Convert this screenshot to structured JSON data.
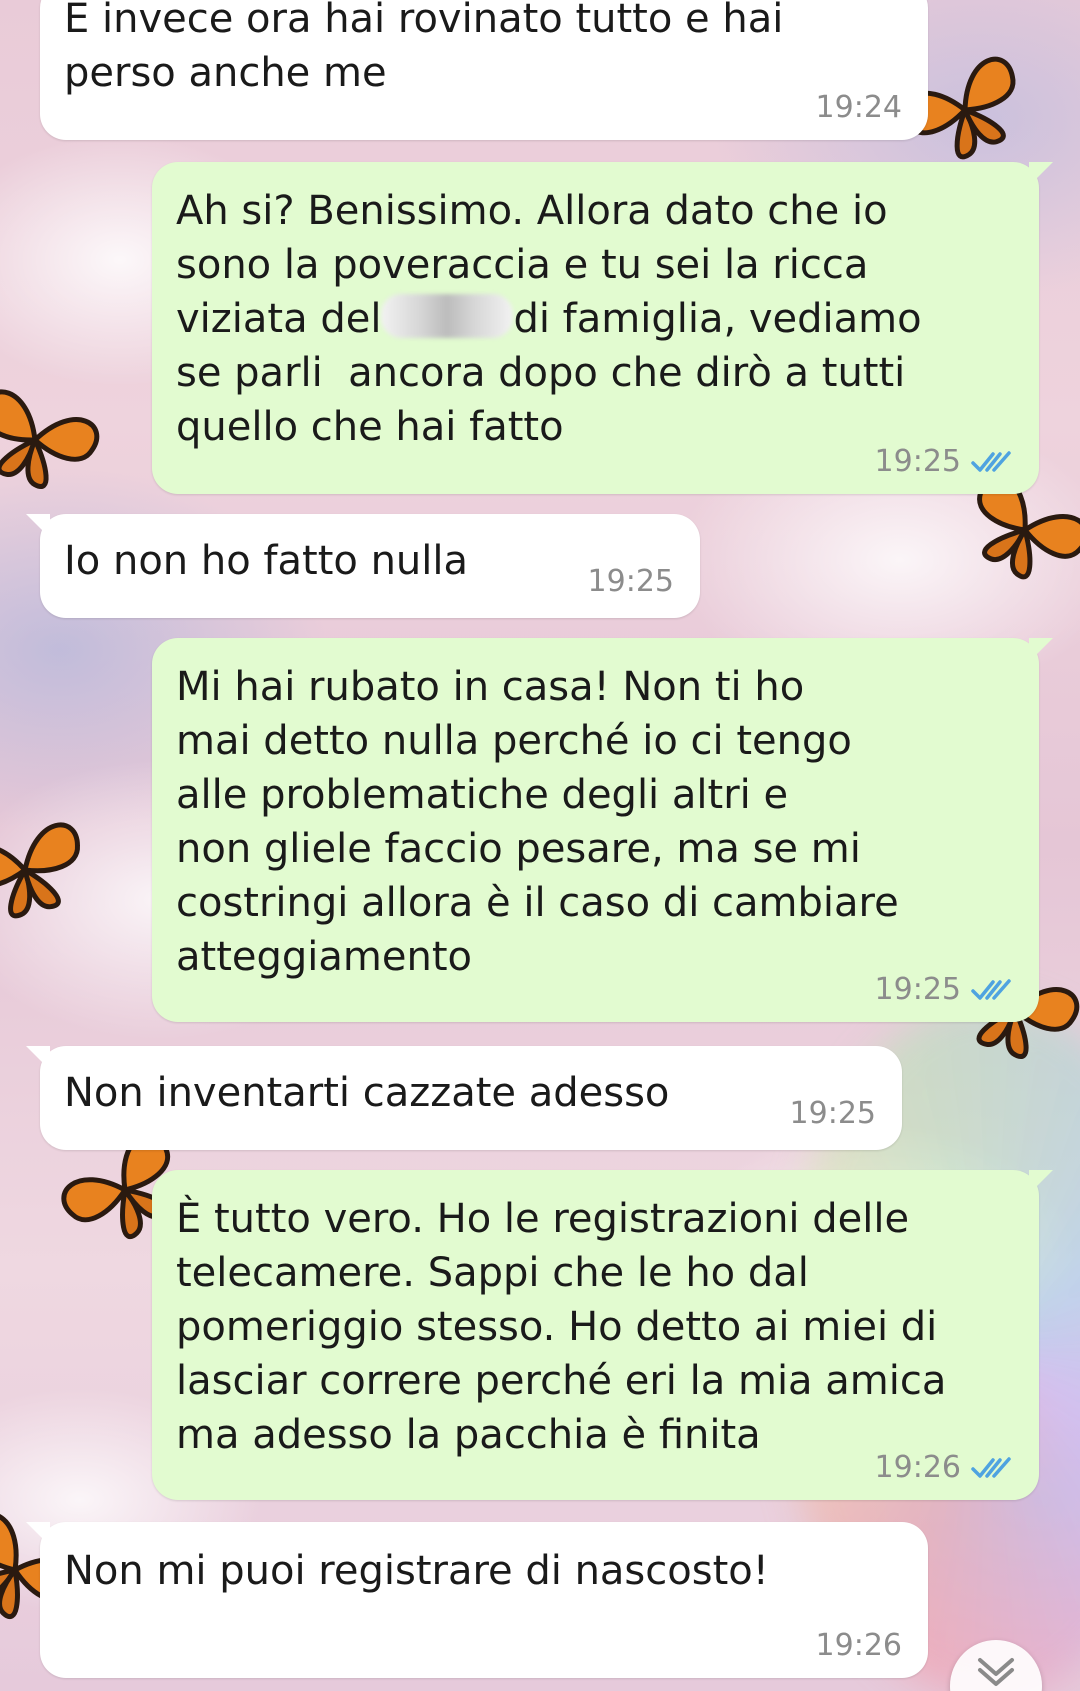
{
  "messages": [
    {
      "direction": "in",
      "text": "E invece ora hai rovinato tutto e hai\nperso anche me",
      "time": "19:24"
    },
    {
      "direction": "out",
      "text_a": "Ah si? Benissimo. Allora dato che io\nsono la poveraccia e tu sei la ricca\nviziata del",
      "text_b": "di famiglia, vediamo\nse parli  ancora dopo che dirò a tutti\nquello che hai fatto",
      "time": "19:25",
      "status": "read"
    },
    {
      "direction": "in",
      "text": "Io non ho fatto nulla",
      "time": "19:25"
    },
    {
      "direction": "out",
      "text": "Mi hai rubato in casa! Non ti ho\nmai detto nulla perché io ci tengo\nalle problematiche degli altri e\nnon gliele faccio pesare, ma se mi\ncostringi allora è il caso di cambiare\natteggiamento",
      "time": "19:25",
      "status": "read"
    },
    {
      "direction": "in",
      "text": "Non inventarti cazzate adesso",
      "time": "19:25"
    },
    {
      "direction": "out",
      "text": "È tutto vero. Ho le registrazioni delle\ntelecamere. Sappi che le ho dal\npomeriggio stesso. Ho detto ai miei di\nlasciar correre perché eri la mia amica\nma adesso la pacchia è finita",
      "time": "19:26",
      "status": "read"
    },
    {
      "direction": "in",
      "text": "Non mi puoi registrare di nascosto!",
      "time": "19:26"
    }
  ],
  "colors": {
    "incoming_bubble": "#ffffff",
    "outgoing_bubble": "#e2fbd0",
    "read_ticks": "#4fa3e0",
    "timestamp": "#8c8c8c"
  },
  "icons": {
    "read_status": "double-check-icon",
    "scroll_down": "chevron-down-icon",
    "wallpaper_motif": "butterfly-icon"
  }
}
